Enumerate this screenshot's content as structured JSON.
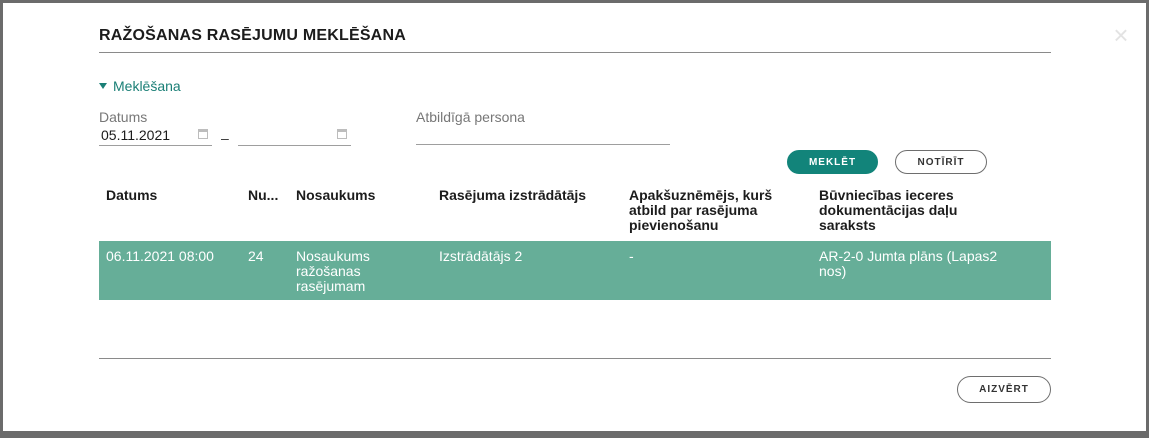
{
  "dialog": {
    "title": "RAŽOŠANAS RASĒJUMU MEKLĒŠANA",
    "close_icon": "×"
  },
  "search": {
    "toggle_label": "Meklēšana",
    "date_label": "Datums",
    "date_from": "05.11.2021",
    "date_to": "",
    "range_separator": "–",
    "person_label": "Atbildīgā persona",
    "person_value": "",
    "search_button": "MEKLĒT",
    "clear_button": "NOTĪRĪT"
  },
  "table": {
    "columns": [
      "Datums",
      "Nu...",
      "Nosaukums",
      "Rasējuma izstrādātājs",
      "Apakšuznēmējs, kurš atbild par rasējuma pievienošanu",
      "Būvniecības ieceres dokumentācijas daļu saraksts"
    ],
    "rows": [
      [
        "06.11.2021 08:00",
        "24",
        "Nosaukums ražošanas rasējumam",
        "Izstrādātājs 2",
        "-",
        "AR-2-0 Jumta plāns (Lapas2 nos)"
      ]
    ]
  },
  "footer": {
    "close_button": "AIZVĒRT"
  },
  "colors": {
    "accent": "#12847a",
    "row_highlight": "#66ae98",
    "backdrop": "#6b6b6b"
  },
  "icons": {
    "toggle": "caret-down-icon",
    "date": "calendar-icon",
    "close": "close-icon"
  }
}
